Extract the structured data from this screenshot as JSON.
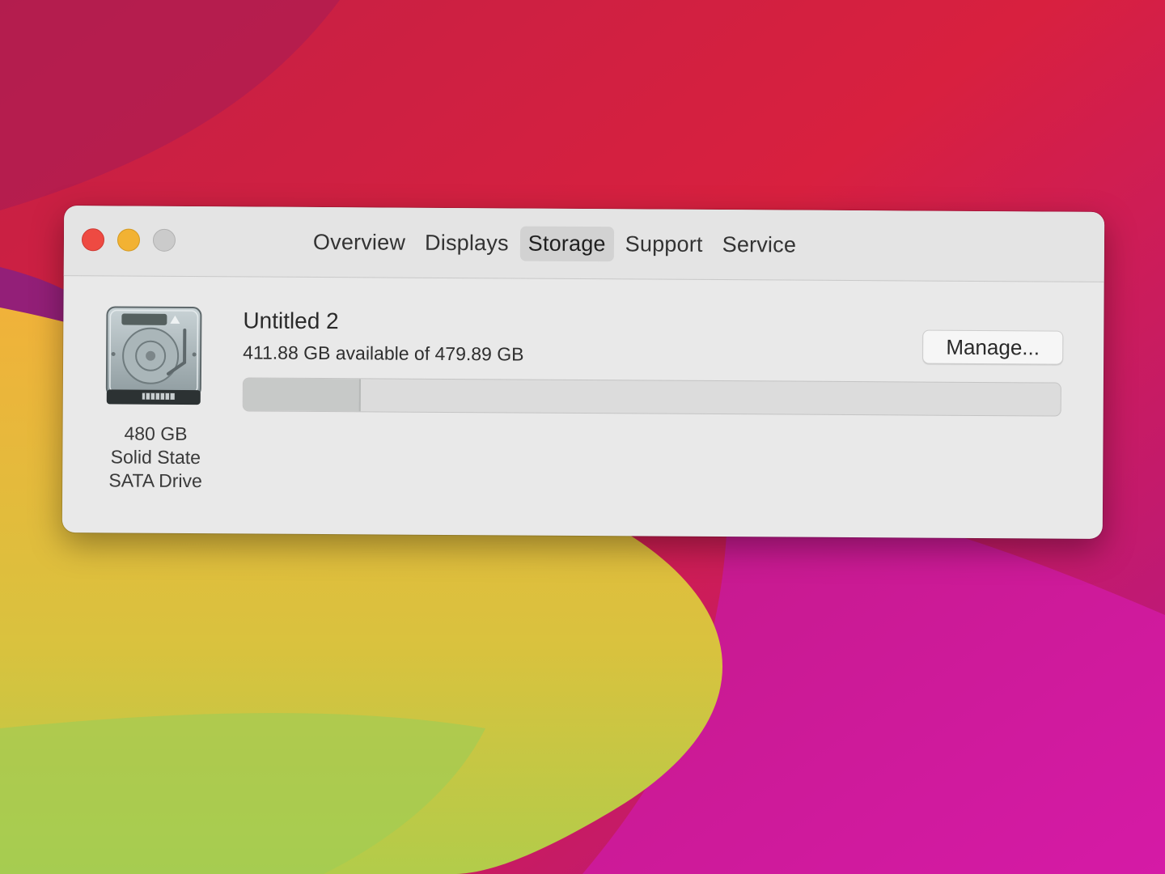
{
  "window": {
    "tabs": [
      "Overview",
      "Displays",
      "Storage",
      "Support",
      "Service"
    ],
    "active_tab": "Storage"
  },
  "drive": {
    "icon": "hard-drive-icon",
    "caption_line1": "480 GB",
    "caption_line2": "Solid State",
    "caption_line3": "SATA Drive"
  },
  "volume": {
    "name": "Untitled 2",
    "availability": "411.88 GB available of 479.89 GB",
    "used_fraction": 0.142,
    "manage_label": "Manage..."
  },
  "colors": {
    "close": "#ee4a42",
    "minimize": "#f2b233",
    "zoom": "#cbcbcb"
  }
}
